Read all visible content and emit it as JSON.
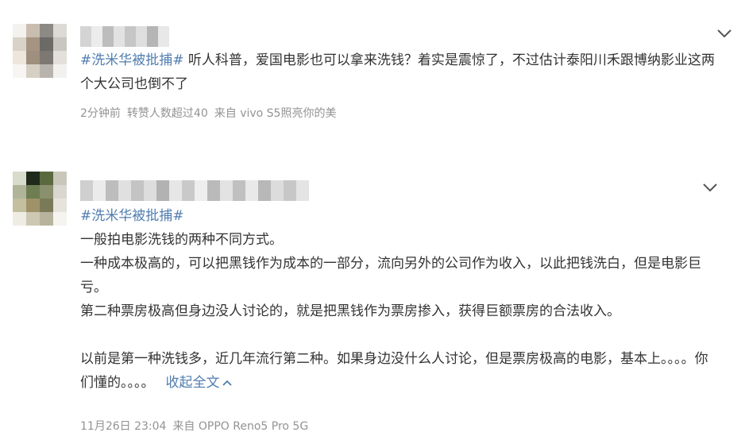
{
  "posts": [
    {
      "topic": "#洗米华被批捕#",
      "text": " 听人科普，爱国电影也可以拿来洗钱？着实是震惊了，不过估计泰阳川禾跟博纳影业这两个大公司也倒不了",
      "time": "2分钟前",
      "reposts": "转赞人数超过40",
      "source": "来自 vivo S5照亮你的美",
      "menu_icon": "chevron-down-icon"
    },
    {
      "topic": "#洗米华被批捕#",
      "paragraphs": [
        "一般拍电影洗钱的两种不同方式。",
        "一种成本极高的，可以把黑钱作为成本的一部分，流向另外的公司作为收入，以此把钱洗白，但是电影巨亏。",
        "第二种票房极高但身边没人讨论的，就是把黑钱作为票房掺入，获得巨额票房的合法收入。"
      ],
      "last_paragraph": "以前是第一种洗钱多，近几年流行第二种。如果身边没什么人讨论，但是票房极高的电影，基本上。。。。你们懂的。。。。",
      "collapse_label": "收起全文",
      "time": "11月26日 23:04",
      "source": "来自 OPPO Reno5 Pro 5G",
      "menu_icon": "chevron-down-icon"
    }
  ],
  "colors": {
    "link": "#507daf",
    "meta": "#939393",
    "text": "#333333"
  }
}
